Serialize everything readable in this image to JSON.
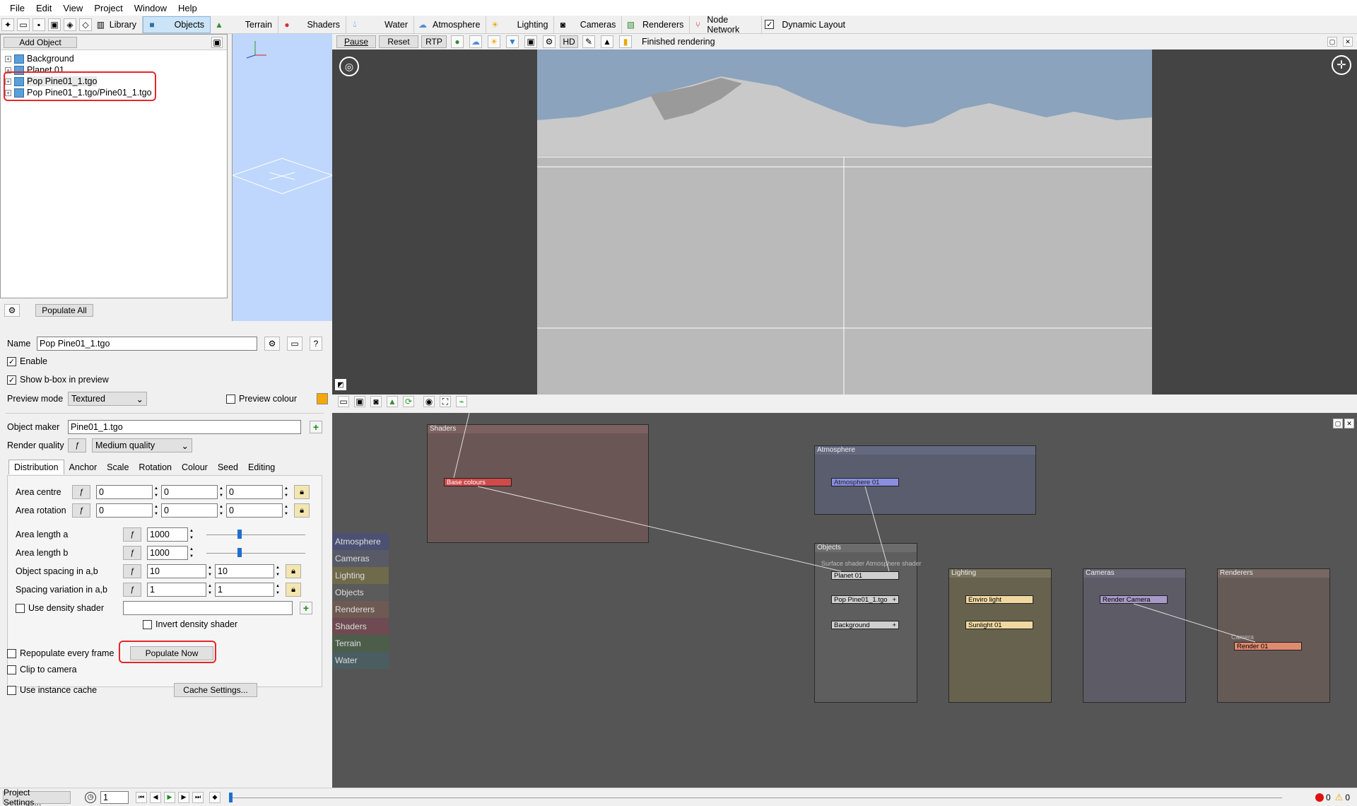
{
  "menu": [
    "File",
    "Edit",
    "View",
    "Project",
    "Window",
    "Help"
  ],
  "toolbar": {
    "library": "Library",
    "objects": "Objects",
    "terrain": "Terrain",
    "shaders": "Shaders",
    "water": "Water",
    "atmosphere": "Atmosphere",
    "lighting": "Lighting",
    "cameras": "Cameras",
    "renderers": "Renderers",
    "node_network": "Node Network",
    "dynamic_layout": "Dynamic Layout"
  },
  "tree": {
    "add_object": "Add Object",
    "items": [
      "Background",
      "Planet 01",
      "Pop Pine01_1.tgo",
      "Pop Pine01_1.tgo/Pine01_1.tgo"
    ],
    "populate_all": "Populate All"
  },
  "props": {
    "name_label": "Name",
    "name_value": "Pop Pine01_1.tgo",
    "enable": "Enable",
    "show_bbox": "Show b-box in preview",
    "preview_mode_label": "Preview mode",
    "preview_mode_value": "Textured",
    "preview_colour": "Preview colour",
    "preview_colour_hex": "#f5a800",
    "object_maker_label": "Object maker",
    "object_maker_value": "Pine01_1.tgo",
    "render_quality_label": "Render quality",
    "render_quality_value": "Medium quality",
    "tabs": [
      "Distribution",
      "Anchor",
      "Scale",
      "Rotation",
      "Colour",
      "Seed",
      "Editing"
    ],
    "area_centre": "Area centre",
    "area_rotation": "Area rotation",
    "area_length_a": "Area length a",
    "area_length_b": "Area length b",
    "object_spacing": "Object spacing in a,b",
    "spacing_variation": "Spacing variation in a,b",
    "use_density_shader": "Use density shader",
    "invert_density_shader": "Invert density shader",
    "repopulate": "Repopulate every frame",
    "populate_now": "Populate Now",
    "clip_to_camera": "Clip to camera",
    "use_instance_cache": "Use instance cache",
    "cache_settings": "Cache Settings...",
    "vals": {
      "centre": [
        "0",
        "0",
        "0"
      ],
      "rotation": [
        "0",
        "0",
        "0"
      ],
      "length_a": "1000",
      "length_b": "1000",
      "spacing": [
        "10",
        "10"
      ],
      "variation": [
        "1",
        "1"
      ]
    }
  },
  "render": {
    "pause": "Pause",
    "reset": "Reset",
    "rtp": "RTP",
    "hd": "HD",
    "status": "Finished rendering"
  },
  "nodes": {
    "side": [
      "Atmosphere",
      "Cameras",
      "Lighting",
      "Objects",
      "Renderers",
      "Shaders",
      "Terrain",
      "Water"
    ],
    "side_colors": [
      "#4c5173",
      "#585a66",
      "#6e6a4a",
      "#5b5b5b",
      "#6e5a52",
      "#6e4a52",
      "#4c5e4a",
      "#4a5e62"
    ],
    "groups": {
      "shaders": "Shaders",
      "atmosphere": "Atmosphere",
      "objects": "Objects",
      "lighting": "Lighting",
      "cameras": "Cameras",
      "renderers": "Renderers"
    },
    "base_colours": "Base colours",
    "atmosphere_01": "Atmosphere 01",
    "obj_ports": "Surface shader Atmosphere shader",
    "planet_01": "Planet 01",
    "pop_pine": "Pop Pine01_1.tgo",
    "background": "Background",
    "enviro_light": "Enviro light",
    "sunlight_01": "Sunlight 01",
    "render_camera": "Render Camera",
    "camera_port": "Camera",
    "render_01": "Render 01"
  },
  "status": {
    "project_settings": "Project Settings...",
    "frame": "1",
    "errors": "0",
    "warnings": "0"
  }
}
